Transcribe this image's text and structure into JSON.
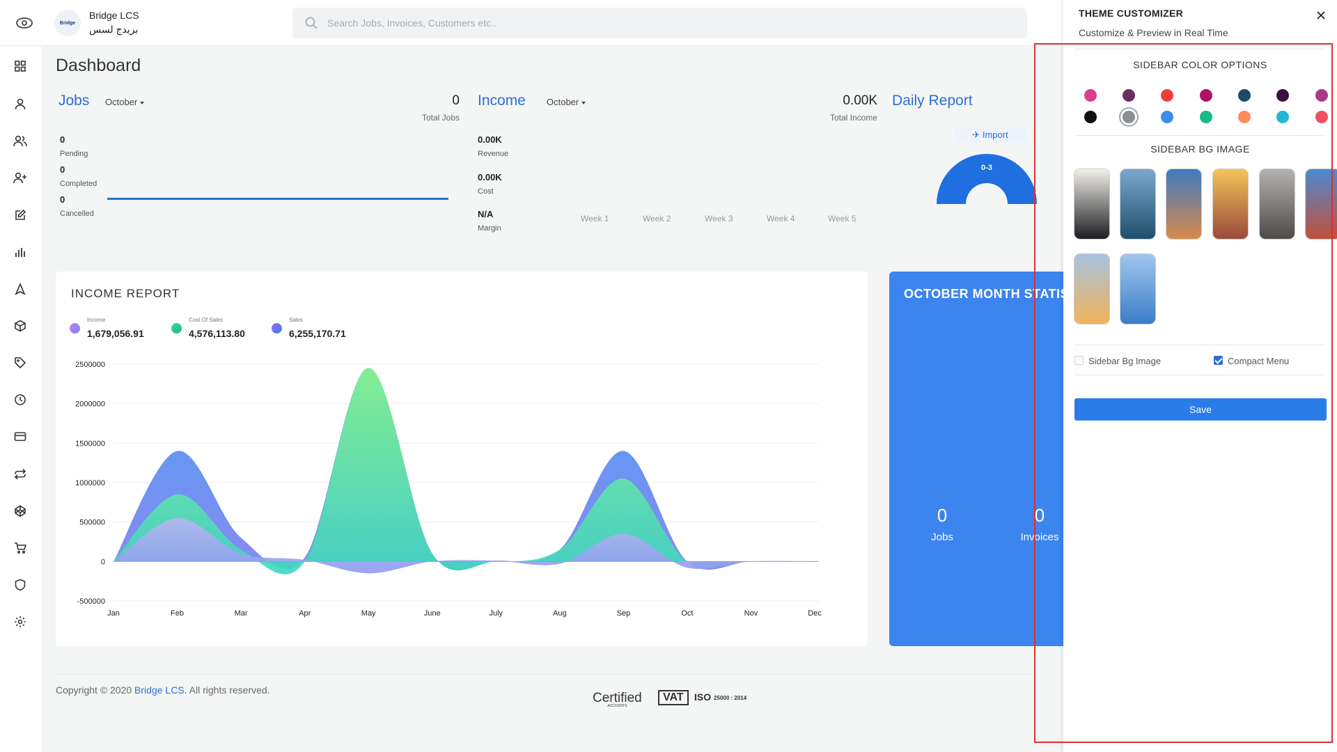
{
  "header": {
    "brand_name": "Bridge LCS",
    "brand_name_arabic": "بريدج لسس",
    "logo_text": "Bridge",
    "search_placeholder": "Search Jobs, Invoices, Customers etc.."
  },
  "sidebar": {
    "icons": [
      "dashboard-icon",
      "user-icon",
      "users-icon",
      "add-user-icon",
      "edit-icon",
      "bar-chart-icon",
      "navigation-icon",
      "package-icon",
      "tag-icon",
      "clock-icon",
      "credit-card-icon",
      "transfer-icon",
      "codepen-icon",
      "cart-icon",
      "shield-icon",
      "settings-icon"
    ]
  },
  "dashboard": {
    "title": "Dashboard",
    "jobs": {
      "title": "Jobs",
      "month": "October",
      "total_value": "0",
      "total_label": "Total Jobs",
      "stats": [
        {
          "value": "0",
          "label": "Pending"
        },
        {
          "value": "0",
          "label": "Completed"
        },
        {
          "value": "0",
          "label": "Cancelled"
        }
      ]
    },
    "income": {
      "title": "Income",
      "month": "October",
      "total_value": "0.00K",
      "total_label": "Total Income",
      "stats": [
        {
          "value": "0.00K",
          "label": "Revenue"
        },
        {
          "value": "0.00K",
          "label": "Cost"
        },
        {
          "value": "N/A",
          "label": "Margin"
        }
      ],
      "weeks": [
        "Week 1",
        "Week 2",
        "Week 3",
        "Week 4",
        "Week 5"
      ]
    },
    "daily_report": {
      "title": "Daily Report",
      "import_label": "Import",
      "gauge_label": "0-3"
    }
  },
  "income_report": {
    "title": "INCOME REPORT",
    "legend": [
      {
        "label": "Income",
        "value": "1,679,056.91",
        "color": "#9b7df0"
      },
      {
        "label": "Cost Of Sales",
        "value": "4,576,113.80",
        "color": "#2ed3a0"
      },
      {
        "label": "Sales",
        "value": "6,255,170.71",
        "color": "#5a7df0"
      }
    ]
  },
  "chart_data": {
    "type": "area",
    "title": "INCOME REPORT",
    "categories": [
      "Jan",
      "Feb",
      "Mar",
      "Apr",
      "May",
      "June",
      "July",
      "Aug",
      "Sep",
      "Oct",
      "Nov",
      "Dec"
    ],
    "ylim": [
      -500000,
      2500000
    ],
    "yticks": [
      2500000,
      2000000,
      1500000,
      1000000,
      500000,
      0,
      -500000
    ],
    "series": [
      {
        "name": "Sales",
        "color": "#4c8ff0",
        "values": [
          0,
          1400000,
          300000,
          50000,
          2450000,
          100000,
          10000,
          150000,
          1400000,
          0,
          0,
          0
        ]
      },
      {
        "name": "Cost Of Sales",
        "color": "#3dd6a3",
        "values": [
          0,
          850000,
          150000,
          0,
          2450000,
          100000,
          0,
          150000,
          1050000,
          0,
          0,
          0
        ]
      },
      {
        "name": "Income",
        "color": "#a3a5f0",
        "values": [
          0,
          550000,
          100000,
          20000,
          -150000,
          0,
          10000,
          -30000,
          350000,
          -80000,
          0,
          0
        ]
      }
    ],
    "grid": true
  },
  "month_stats": {
    "title": "OCTOBER MONTH STATISTICS",
    "items": [
      {
        "value": "0",
        "label": "Jobs"
      },
      {
        "value": "0",
        "label": "Invoices"
      }
    ]
  },
  "footer": {
    "copyright_prefix": "Copyright © 2020 ",
    "company": "Bridge LCS",
    "copyright_suffix": ". All rights reserved.",
    "cert_label": "Certified",
    "cert_sub": "ACCOUNTS",
    "vat_label": "VAT",
    "iso_label": "ISO",
    "iso_num": "25000 : 2014"
  },
  "customizer": {
    "title": "THEME CUSTOMIZER",
    "subtitle": "Customize & Preview in Real Time",
    "color_section": "SIDEBAR COLOR OPTIONS",
    "colors": [
      "#d6408f",
      "#6a2e5e",
      "#ef3e3e",
      "#b0125f",
      "#1e4a6a",
      "#3a1044",
      "#a83b8a",
      "#111111",
      "#8a8f98",
      "#3c8cef",
      "#16b98a",
      "#ff8a5c",
      "#22b8d3",
      "#f24f63"
    ],
    "bg_section": "SIDEBAR BG IMAGE",
    "thumbnails": [
      {
        "name": "crane",
        "colors": [
          "#f2f0ea",
          "#1d1d22"
        ]
      },
      {
        "name": "cargo-ship",
        "colors": [
          "#7aa8d0",
          "#1f4f6c"
        ]
      },
      {
        "name": "containers",
        "colors": [
          "#3d7ac0",
          "#d98a4a"
        ]
      },
      {
        "name": "harbor-sunset",
        "colors": [
          "#f3c45a",
          "#9a4a3a"
        ]
      },
      {
        "name": "truck",
        "colors": [
          "#b4b1b0",
          "#4d4a49"
        ]
      },
      {
        "name": "port-crane",
        "colors": [
          "#4d8ad2",
          "#c24f3a"
        ]
      },
      {
        "name": "plane-sunset",
        "colors": [
          "#a7c3e0",
          "#f0b35a"
        ]
      },
      {
        "name": "airplane",
        "colors": [
          "#9fc6ef",
          "#3c7dc8"
        ]
      }
    ],
    "checkbox_bg_label": "Sidebar Bg Image",
    "checkbox_compact_label": "Compact Menu",
    "save_label": "Save"
  }
}
